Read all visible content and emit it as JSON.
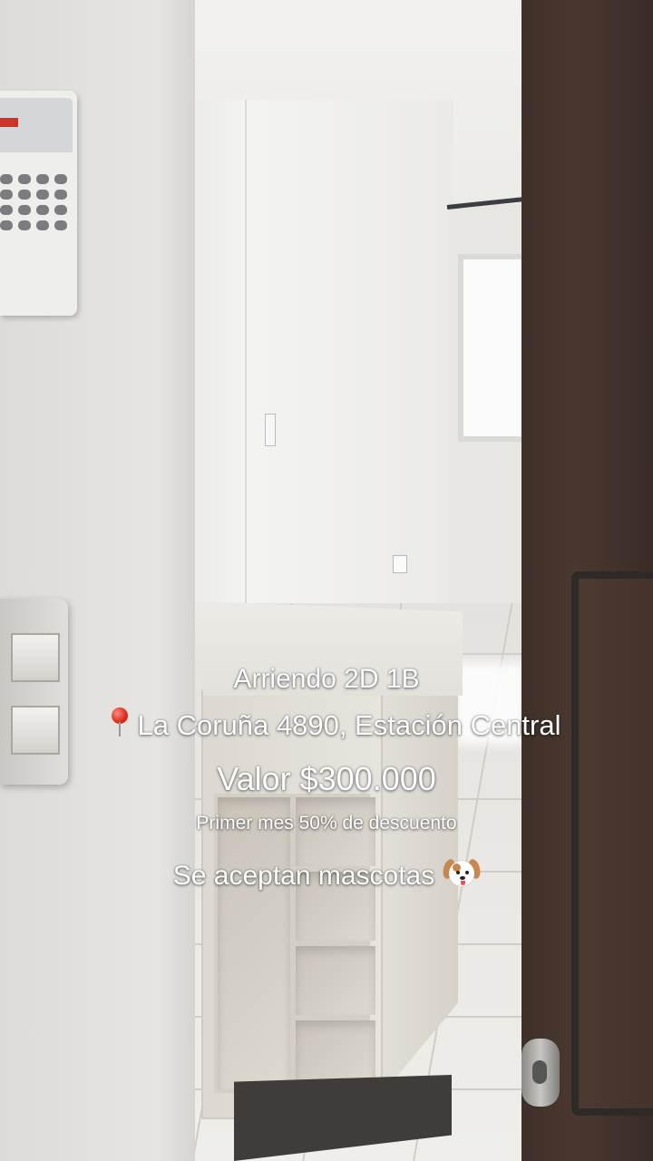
{
  "overlay": {
    "line1": "Arriendo 2D 1B",
    "line2_icon": "round-pushpin-icon",
    "line2": "La Coruña 4890, Estación Central",
    "line3": "Valor $300.000",
    "line4": "Primer mes 50% de descuento",
    "line5": "Se aceptan mascotas",
    "line5_icon": "dog-face-icon"
  }
}
